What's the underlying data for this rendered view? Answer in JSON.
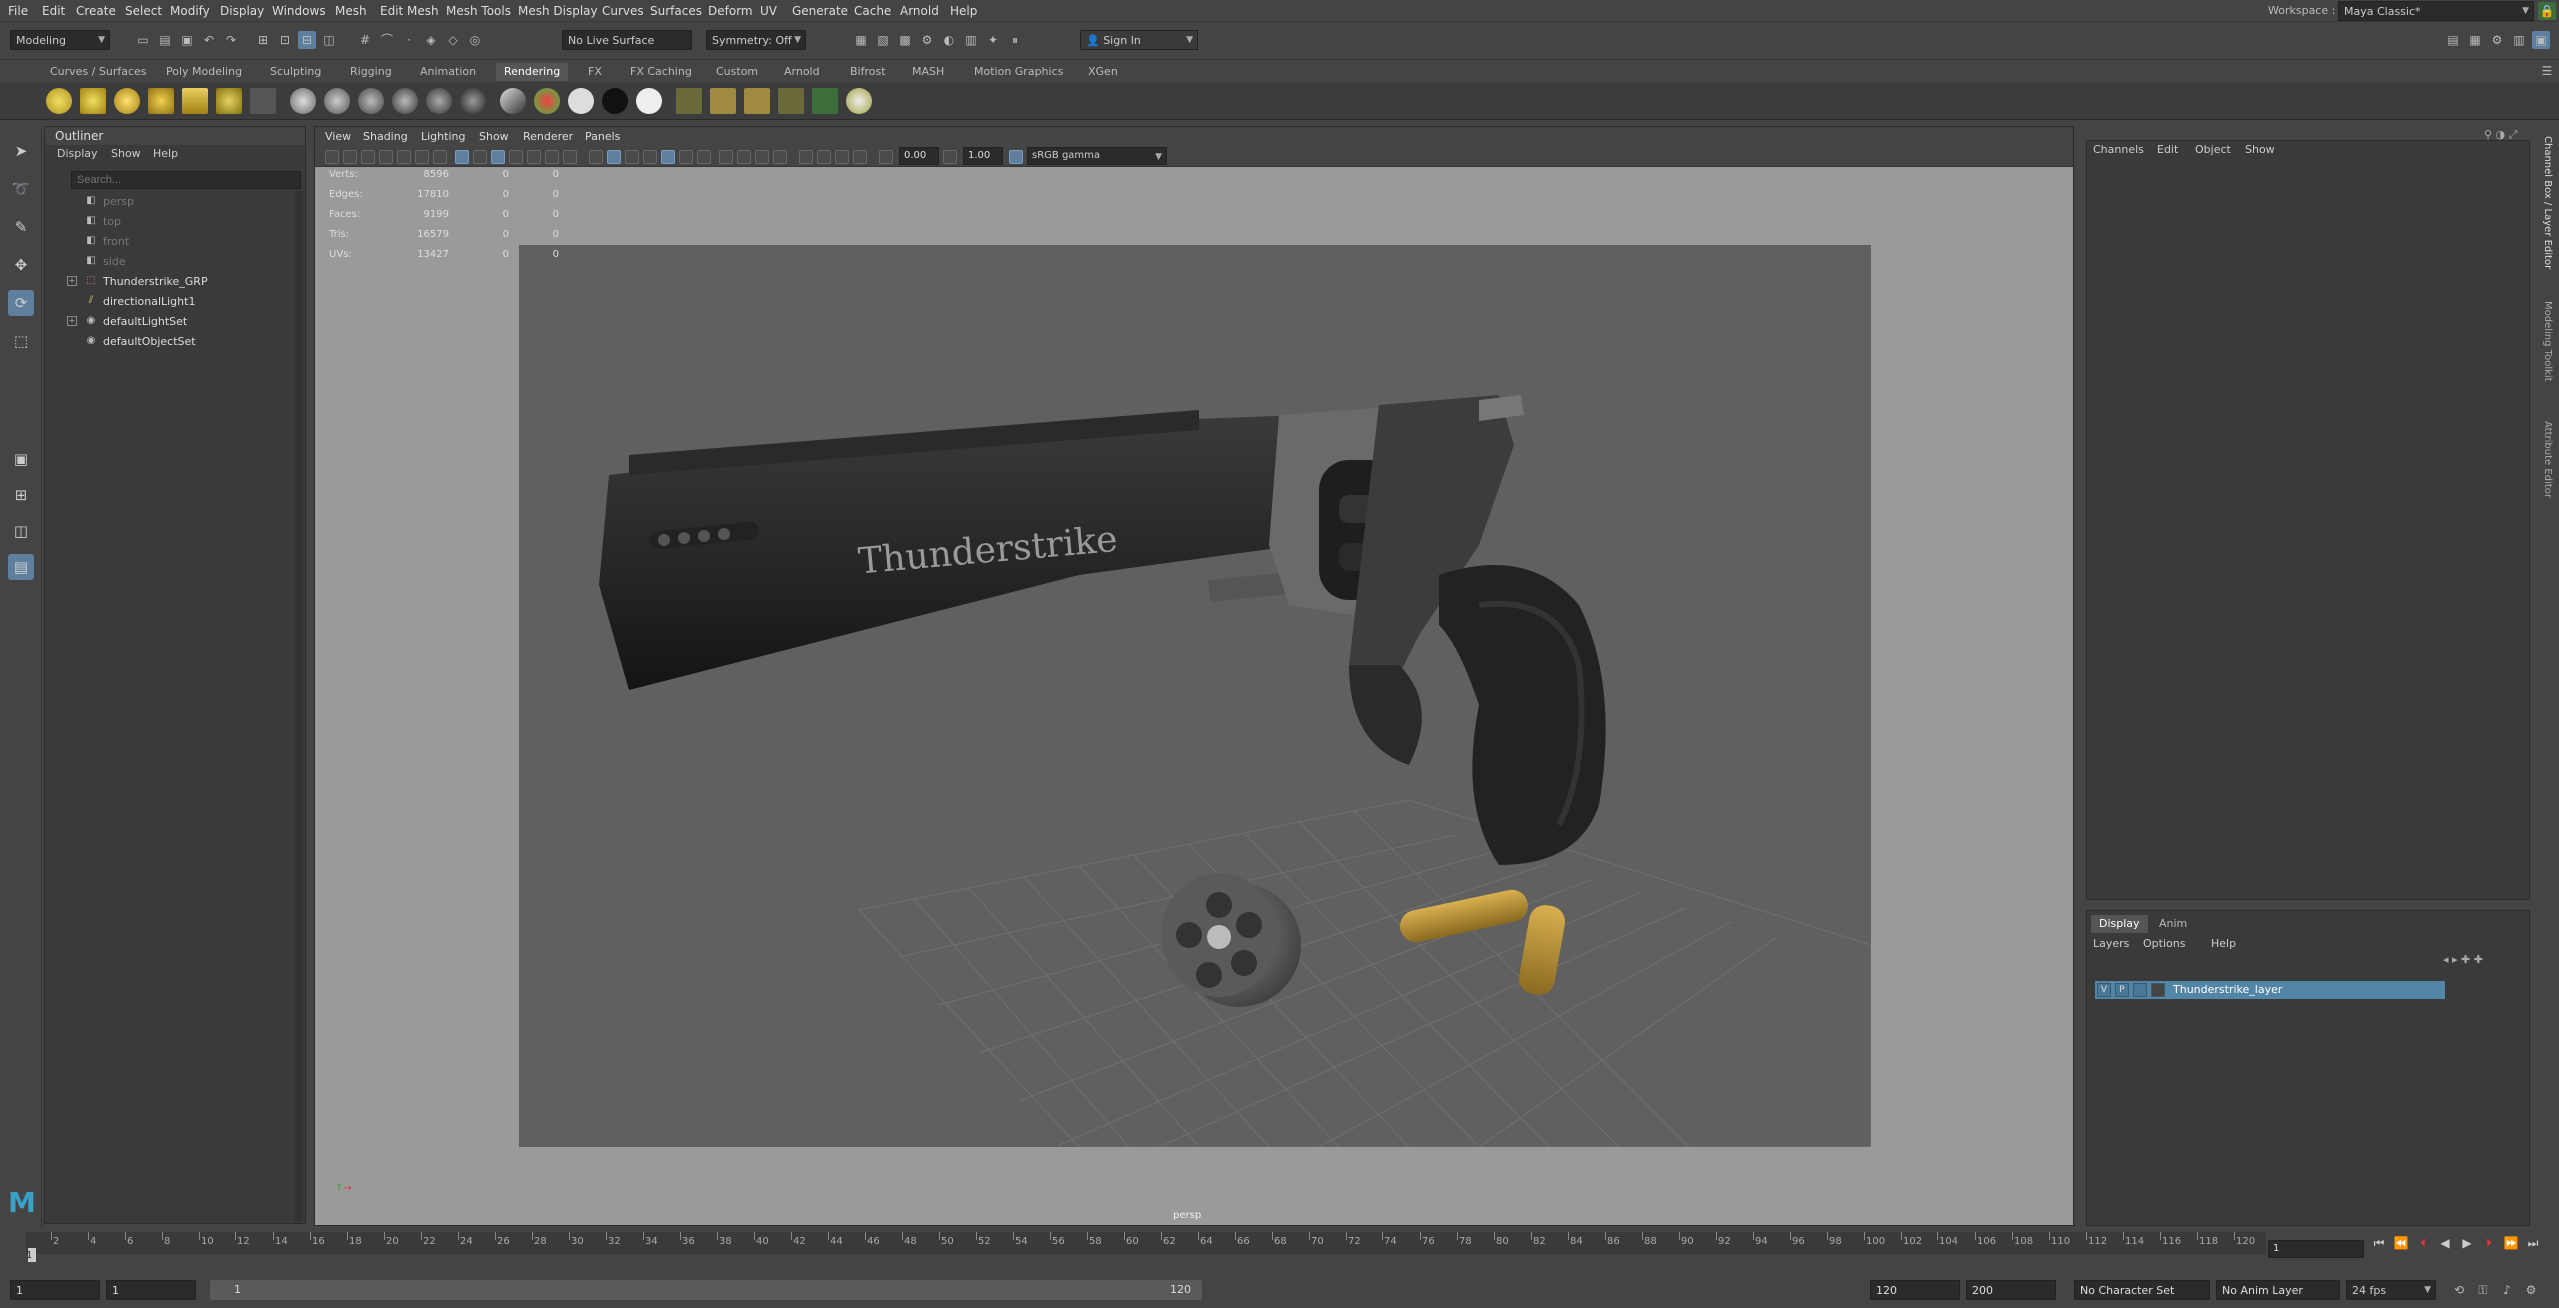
{
  "menubar": {
    "items": [
      "File",
      "Edit",
      "Create",
      "Select",
      "Modify",
      "Display",
      "Windows",
      "Mesh",
      "Edit Mesh",
      "Mesh Tools",
      "Mesh Display",
      "Curves",
      "Surfaces",
      "Deform",
      "UV",
      "Generate",
      "Cache",
      "Arnold",
      "Help"
    ],
    "workspace_label": "Workspace :",
    "workspace_value": "Maya Classic*"
  },
  "statusline": {
    "mode": "Modeling",
    "live_surface": "No Live Surface",
    "symmetry": "Symmetry: Off",
    "sign_in": "Sign In"
  },
  "shelf": {
    "tabs": [
      "Curves / Surfaces",
      "Poly Modeling",
      "Sculpting",
      "Rigging",
      "Animation",
      "Rendering",
      "FX",
      "FX Caching",
      "Custom",
      "Arnold",
      "Bifrost",
      "MASH",
      "Motion Graphics",
      "XGen"
    ],
    "active_tab": "Rendering"
  },
  "outliner": {
    "title": "Outliner",
    "menu": [
      "Display",
      "Show",
      "Help"
    ],
    "search_placeholder": "Search...",
    "items": [
      {
        "label": "persp",
        "icon": "camera-icon",
        "dim": true
      },
      {
        "label": "top",
        "icon": "camera-icon",
        "dim": true
      },
      {
        "label": "front",
        "icon": "camera-icon",
        "dim": true
      },
      {
        "label": "side",
        "icon": "camera-icon",
        "dim": true
      },
      {
        "label": "Thunderstrike_GRP",
        "icon": "group-icon",
        "expandable": true
      },
      {
        "label": "directionalLight1",
        "icon": "light-icon"
      },
      {
        "label": "defaultLightSet",
        "icon": "set-icon",
        "expandable": true
      },
      {
        "label": "defaultObjectSet",
        "icon": "set-icon"
      }
    ]
  },
  "viewport": {
    "menu": [
      "View",
      "Shading",
      "Lighting",
      "Show",
      "Renderer",
      "Panels"
    ],
    "exposure": "0.00",
    "gamma": "1.00",
    "color_space": "sRGB gamma",
    "camera_label": "persp",
    "gun_text": "Thunderstrike",
    "hud": [
      {
        "k": "Verts:",
        "v": "8596",
        "a": "0",
        "b": "0"
      },
      {
        "k": "Edges:",
        "v": "17810",
        "a": "0",
        "b": "0"
      },
      {
        "k": "Faces:",
        "v": "9199",
        "a": "0",
        "b": "0"
      },
      {
        "k": "Tris:",
        "v": "16579",
        "a": "0",
        "b": "0"
      },
      {
        "k": "UVs:",
        "v": "13427",
        "a": "0",
        "b": "0"
      }
    ]
  },
  "channel_box": {
    "menu": [
      "Channels",
      "Edit",
      "Object",
      "Show"
    ]
  },
  "layer_editor": {
    "tabs": [
      "Display",
      "Anim"
    ],
    "active_tab": "Display",
    "menu": [
      "Layers",
      "Options",
      "Help"
    ],
    "layer": {
      "v": "V",
      "p": "P",
      "name": "Thunderstrike_layer"
    }
  },
  "side_tabs": [
    "Channel Box / Layer Editor",
    "Modeling Toolkit",
    "Attribute Editor"
  ],
  "timeline": {
    "ticks": [
      "2",
      "4",
      "6",
      "8",
      "10",
      "12",
      "14",
      "16",
      "18",
      "20",
      "22",
      "24",
      "26",
      "28",
      "30",
      "32",
      "34",
      "36",
      "38",
      "40",
      "42",
      "44",
      "46",
      "48",
      "50",
      "52",
      "54",
      "56",
      "58",
      "60",
      "62",
      "64",
      "66",
      "68",
      "70",
      "72",
      "74",
      "76",
      "78",
      "80",
      "82",
      "84",
      "86",
      "88",
      "90",
      "92",
      "94",
      "96",
      "98",
      "100",
      "102",
      "104",
      "106",
      "108",
      "110",
      "112",
      "114",
      "116",
      "118",
      "120"
    ],
    "current": "1",
    "current_frame_field": "1"
  },
  "range": {
    "start": "1",
    "playback_start": "1",
    "slider_start": "1",
    "slider_end": "120",
    "playback_end": "120",
    "end": "200",
    "character_set": "No Character Set",
    "anim_layer": "No Anim Layer",
    "fps": "24 fps"
  },
  "colors": {
    "accent": "#5285a6",
    "panel": "#444444",
    "viewport_bg": "#9a9a9a"
  }
}
